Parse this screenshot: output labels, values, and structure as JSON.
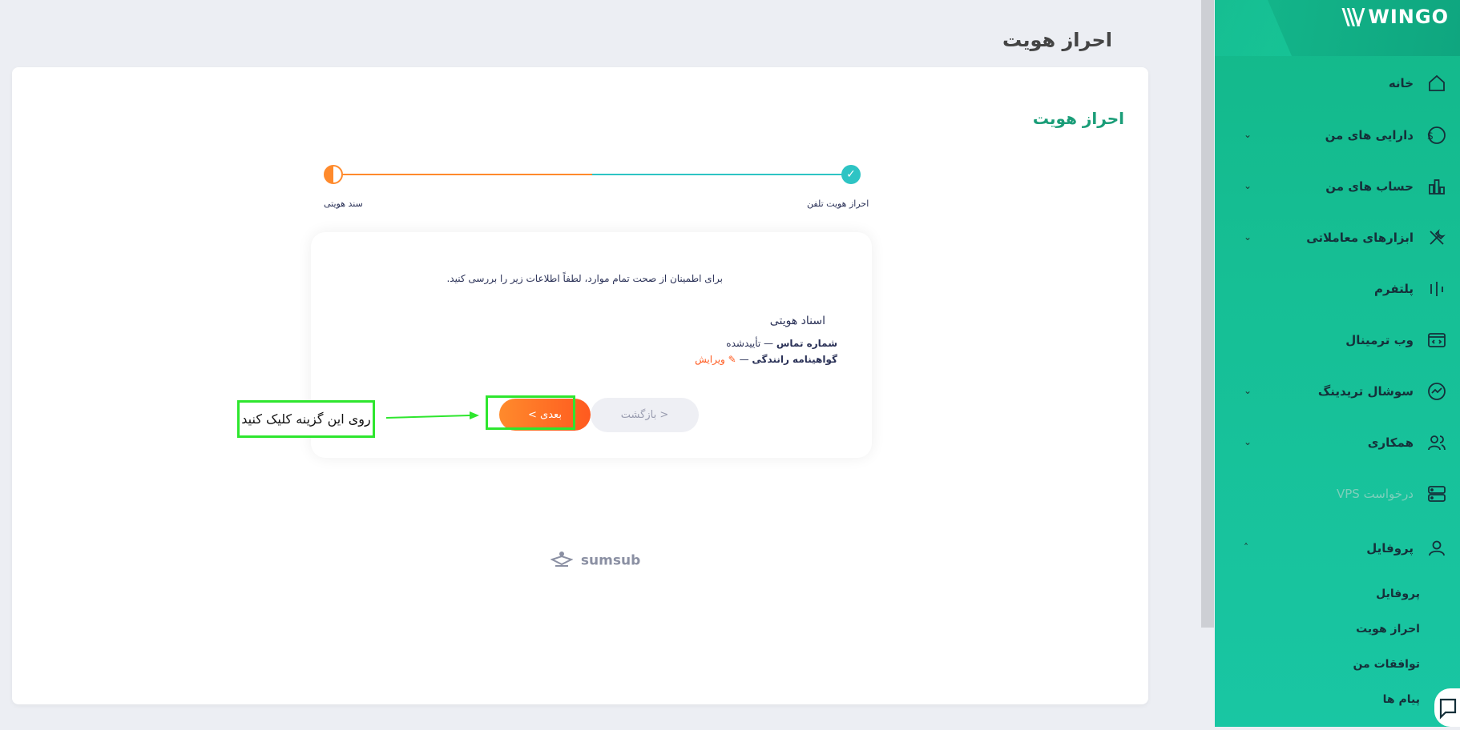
{
  "page": {
    "title": "احراز هویت"
  },
  "card": {
    "title": "احراز هویت",
    "steps": {
      "left_label": "سند هویتی",
      "right_label": "احراز هویت تلفن"
    },
    "instruction": "برای اطمینان از صحت تمام موارد، لطفاً اطلاعات زیر را بررسی کنید.",
    "doc_heading": "اسناد هویتی",
    "doc_lines": [
      {
        "label": "شماره تماس",
        "sep": "—",
        "value": "تأییدشده"
      },
      {
        "label": "گواهینامه رانندگی",
        "sep": "—",
        "value": "ویرایش"
      }
    ],
    "back_button": "< بازگشت",
    "next_button": "بعدی >",
    "annotation": "روی این گزینه کلیک کنید",
    "provider": "sumsub"
  },
  "sidebar": {
    "brand": "WINGO",
    "items": [
      {
        "label": "خانه",
        "icon": "home-icon",
        "has_chevron": false
      },
      {
        "label": "دارایی های من",
        "icon": "dollar-icon",
        "has_chevron": true
      },
      {
        "label": "حساب های من",
        "icon": "accounts-icon",
        "has_chevron": true
      },
      {
        "label": "ابزارهای معاملاتی",
        "icon": "tools-icon",
        "has_chevron": true
      },
      {
        "label": "پلتفرم",
        "icon": "platform-icon",
        "has_chevron": false
      },
      {
        "label": "وب ترمینال",
        "icon": "terminal-icon",
        "has_chevron": false
      },
      {
        "label": "سوشال تریدینگ",
        "icon": "social-icon",
        "has_chevron": true
      },
      {
        "label": "همکاری",
        "icon": "users-icon",
        "has_chevron": true
      },
      {
        "label": "درخواست VPS",
        "icon": "server-icon",
        "has_chevron": false,
        "disabled": true
      },
      {
        "label": "پروفایل",
        "icon": "user-icon",
        "has_chevron": true,
        "expanded": true
      }
    ],
    "sub_items": [
      "پروفایل",
      "احراز هویت",
      "توافقات من",
      "پیام ها"
    ]
  },
  "colors": {
    "accent_green": "#1a9d78",
    "sidebar": "#16bf95",
    "orange": "#ff8a2c",
    "teal": "#2ec4c4",
    "highlight": "#2ee62e"
  }
}
